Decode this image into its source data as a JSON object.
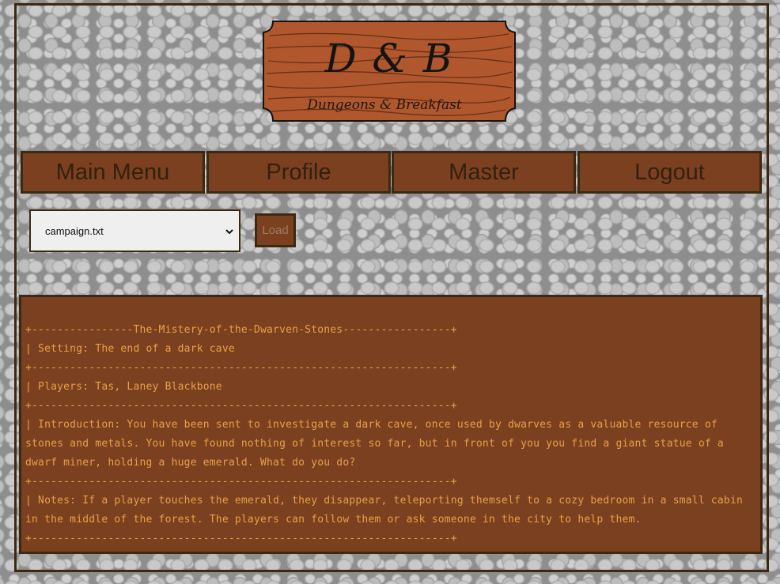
{
  "logo": {
    "title": "D & B",
    "subtitle": "Dungeons & Breakfast"
  },
  "nav": {
    "items": [
      {
        "label": "Main Menu"
      },
      {
        "label": "Profile"
      },
      {
        "label": "Master"
      },
      {
        "label": "Logout"
      }
    ]
  },
  "file_select": {
    "selected": "campaign.txt",
    "icon": "chevron-down-icon"
  },
  "load_button": {
    "label": "Load"
  },
  "campaign_lines": [
    "+----------------The-Mistery-of-the-Dwarven-Stones-----------------+",
    "| Setting: The end of a dark cave",
    "+------------------------------------------------------------------+",
    "| Players: Tas, Laney Blackbone",
    "+------------------------------------------------------------------+",
    "| Introduction: You have been sent to investigate a dark cave, once used by dwarves as a valuable resource of stones and metals. You have found nothing of interest so far, but in front of you you find a giant statue of a dwarf miner, holding a huge emerald. What do you do?",
    "+------------------------------------------------------------------+",
    "| Notes: If a player touches the emerald, they disappear, teleporting themself to a cozy bedroom in a small cabin in the middle of the forest. The players can follow them or ask someone in the city to help them.",
    "+------------------------------------------------------------------+"
  ],
  "colors": {
    "wood": "#7b4020",
    "border": "#3b2a12",
    "text_orange": "#e8a046",
    "sign_wood": "#b0572d"
  }
}
